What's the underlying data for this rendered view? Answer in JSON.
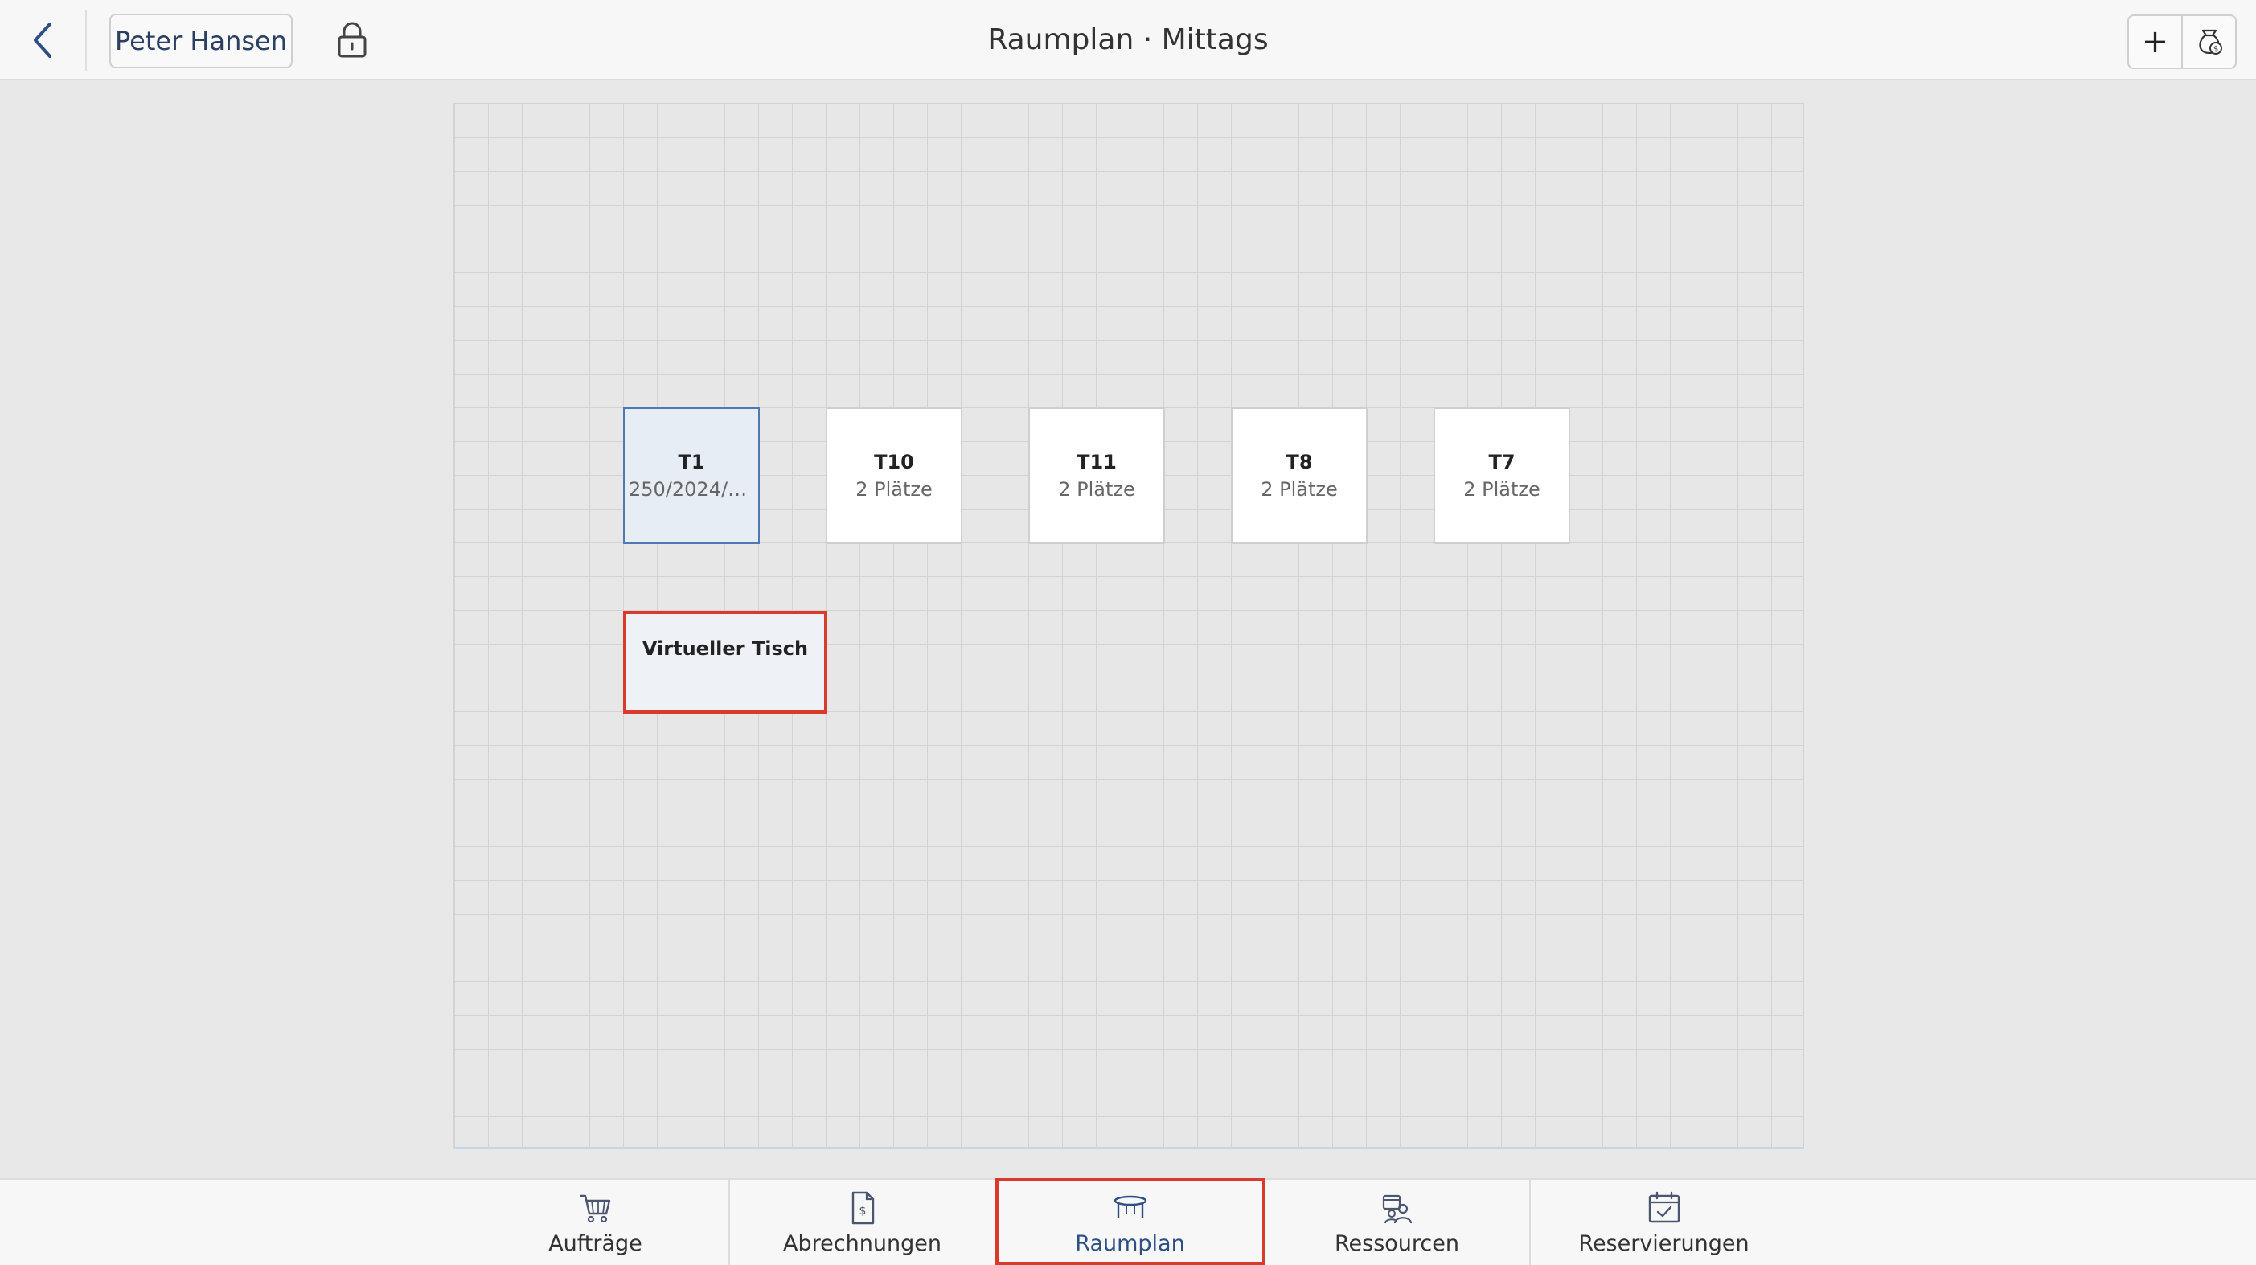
{
  "header": {
    "user_label": "Peter Hansen",
    "title": "Raumplan · Mittags"
  },
  "floorplan": {
    "tables": [
      {
        "name": "T1",
        "info": "250/2024/0...",
        "selected": true
      },
      {
        "name": "T10",
        "info": "2 Plätze",
        "selected": false
      },
      {
        "name": "T11",
        "info": "2 Plätze",
        "selected": false
      },
      {
        "name": "T8",
        "info": "2 Plätze",
        "selected": false
      },
      {
        "name": "T7",
        "info": "2 Plätze",
        "selected": false
      }
    ],
    "virtual_table": {
      "name": "Virtueller Tisch"
    }
  },
  "nav": {
    "items": [
      {
        "label": "Aufträge",
        "icon": "cart-icon"
      },
      {
        "label": "Abrechnungen",
        "icon": "invoice-icon"
      },
      {
        "label": "Raumplan",
        "icon": "table-icon",
        "active": true
      },
      {
        "label": "Ressourcen",
        "icon": "resources-icon"
      },
      {
        "label": "Reservierungen",
        "icon": "calendar-icon"
      }
    ]
  },
  "colors": {
    "accent": "#2d4f86",
    "highlight": "#d93a2b",
    "selected_table_bg": "#e7edf5",
    "selected_table_border": "#4f79b3"
  }
}
